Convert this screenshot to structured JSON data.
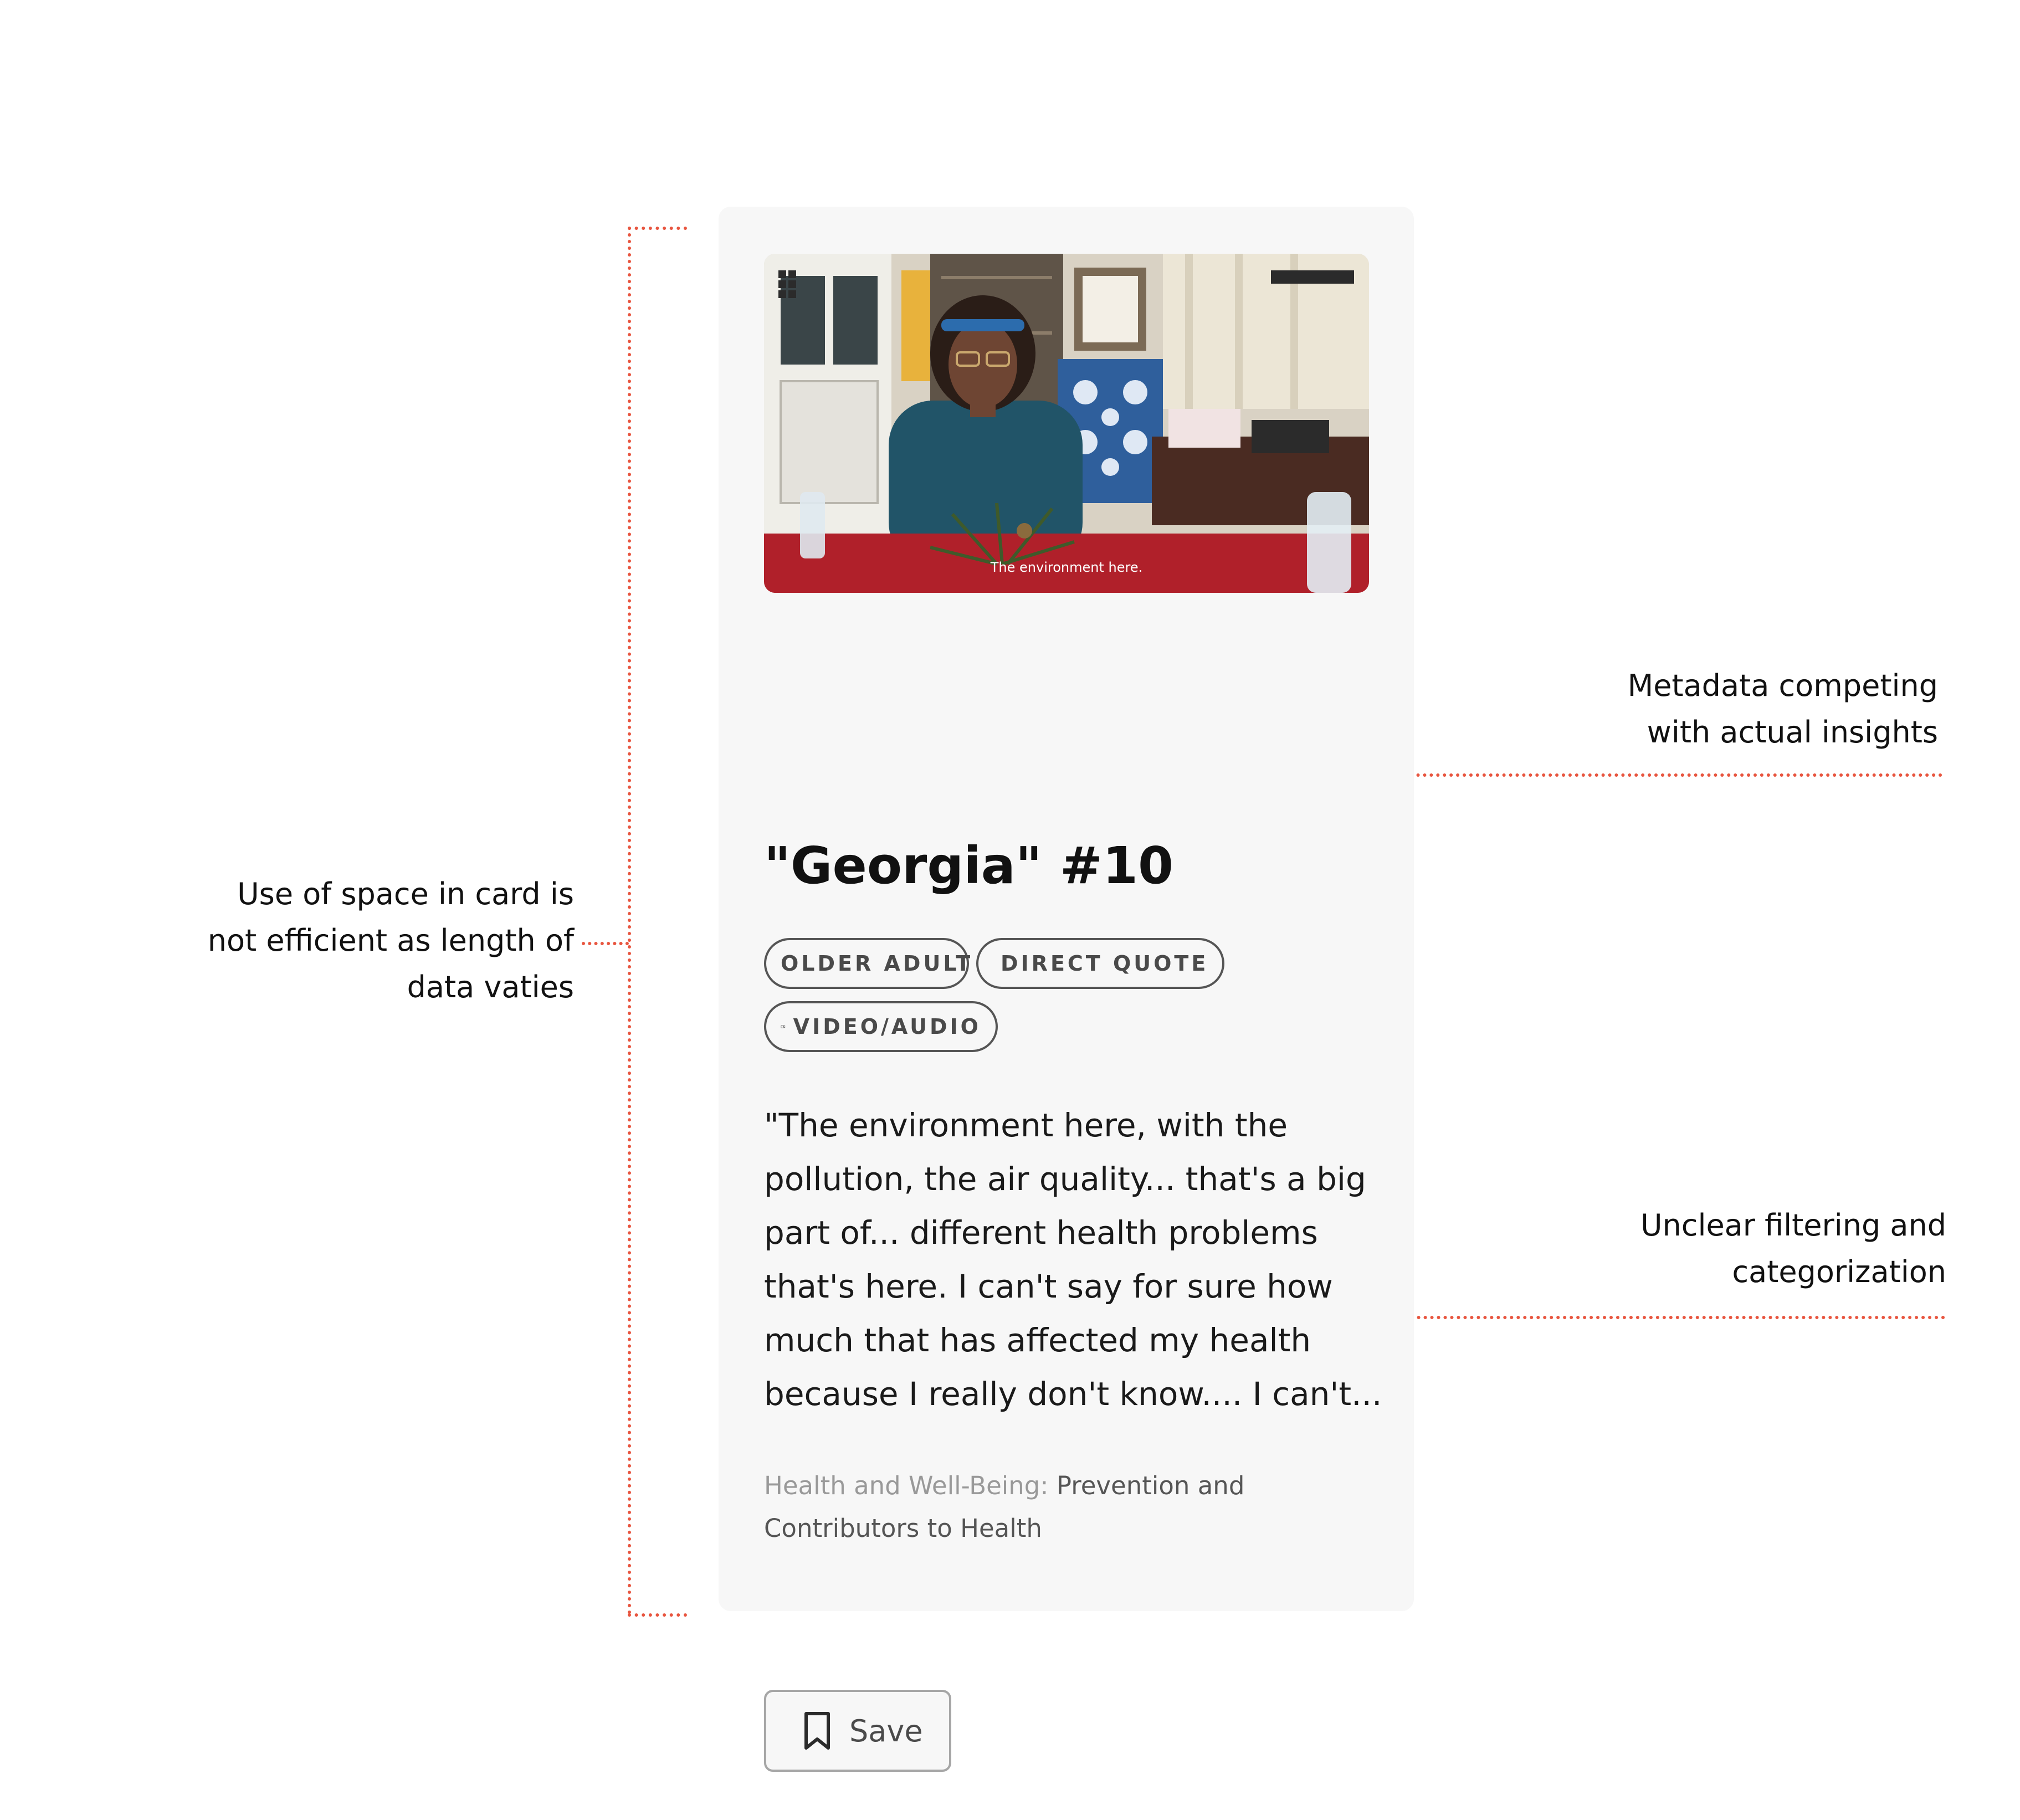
{
  "annotations": {
    "space": [
      "Use of space in card is",
      "not efficient as length of",
      "data vaties"
    ],
    "metadata": [
      "Metadata competing",
      "with actual insights"
    ],
    "filtering": [
      "Unclear filtering and",
      "categorization"
    ]
  },
  "card": {
    "title": "\"Georgia\" #10",
    "video_caption": "The environment here.",
    "tags": [
      {
        "label": "OLDER ADULT",
        "icon": ""
      },
      {
        "label": "DIRECT QUOTE",
        "icon": "speech-icon"
      },
      {
        "label": "VIDEO/AUDIO",
        "icon": "video-icon"
      }
    ],
    "quote_lines": [
      "\"The environment here, with the",
      "pollution, the air quality... that's a big",
      "part of... different health problems",
      "that's here. I can't say for sure how",
      "much that has affected my health",
      "because I really don't know.... I can't..."
    ],
    "category": {
      "label": "Health and Well-Being:",
      "value_line1": "Prevention and",
      "value_line2": "Contributors to Health"
    },
    "save_label": "Save"
  },
  "colors": {
    "annotation_red": "#e8553f",
    "card_bg": "#f7f7f7",
    "tag_border": "#555555"
  }
}
